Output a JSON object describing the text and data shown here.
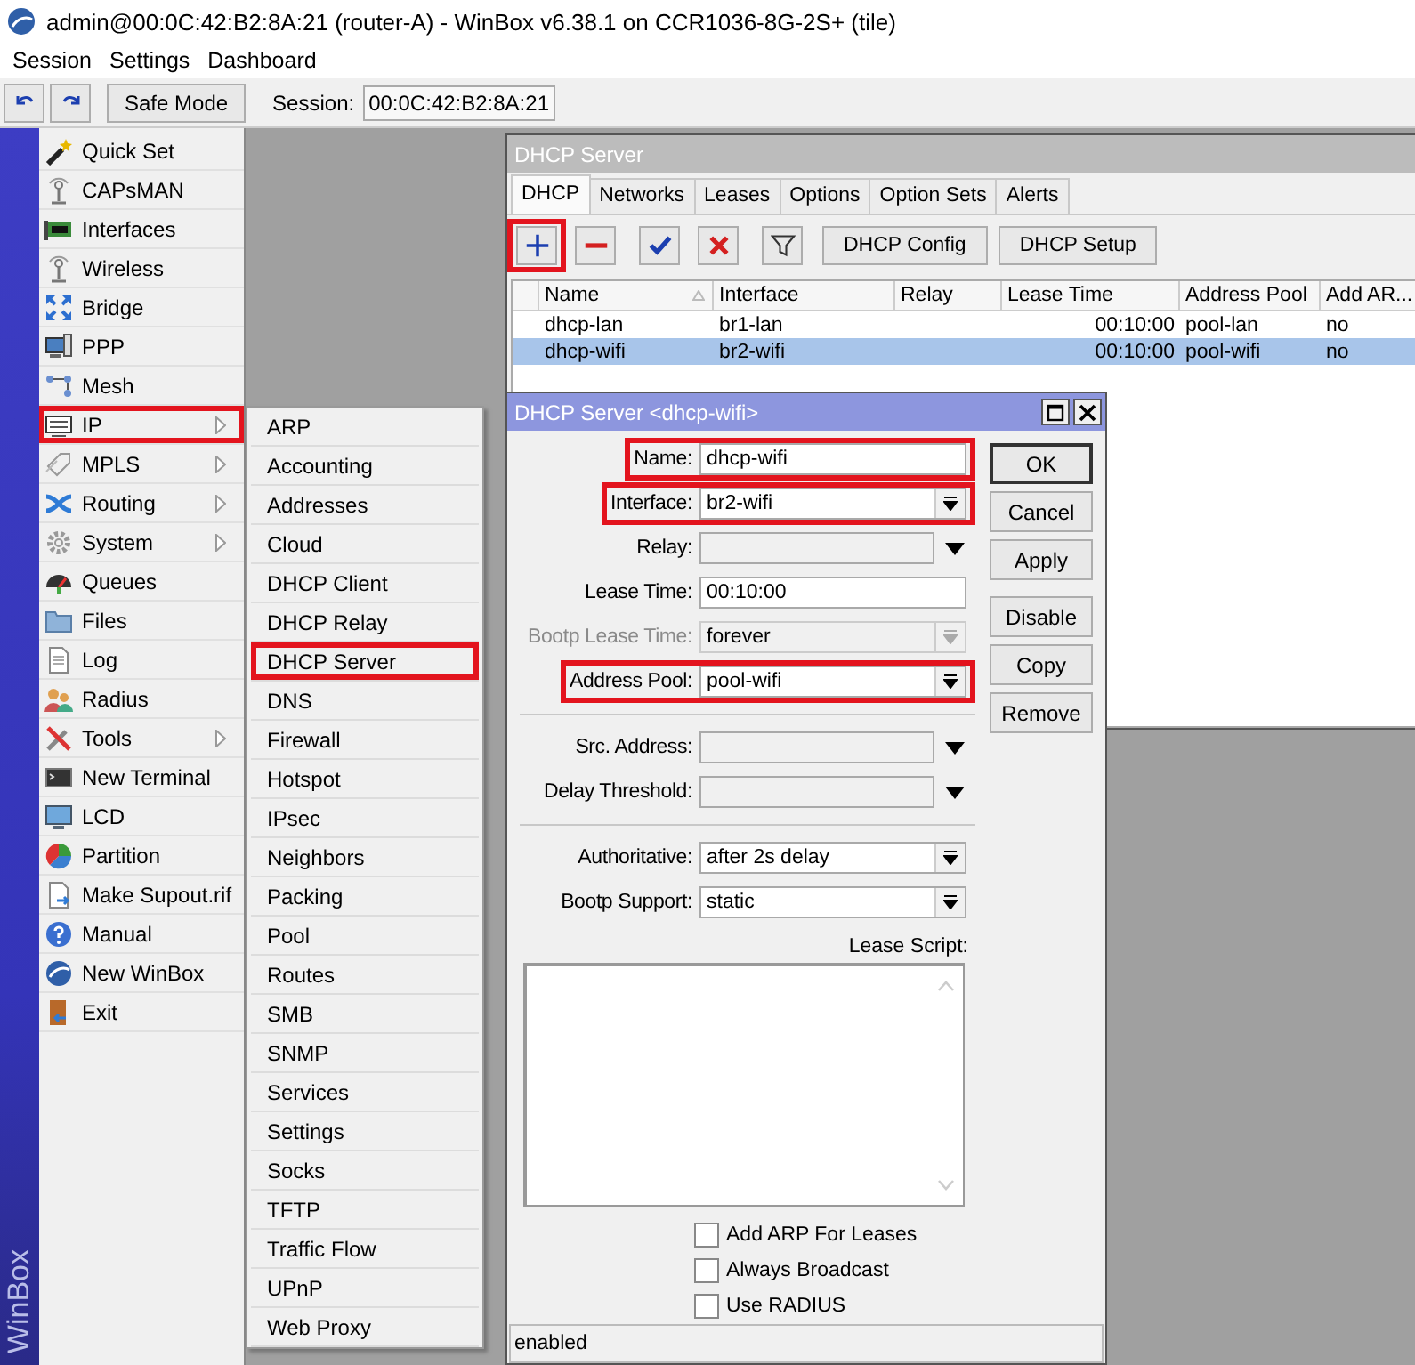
{
  "window": {
    "title": "admin@00:0C:42:B2:8A:21 (router-A) - WinBox v6.38.1 on CCR1036-8G-2S+ (tile)"
  },
  "menu_bar": [
    {
      "label": "Session"
    },
    {
      "label": "Settings"
    },
    {
      "label": "Dashboard"
    }
  ],
  "toolbar": {
    "safe_mode": "Safe Mode",
    "session_label": "Session:",
    "session_value": "00:0C:42:B2:8A:21"
  },
  "side_banner": "WinBox",
  "sidebar": {
    "items": [
      {
        "label": "Quick Set",
        "submenu": false,
        "highlighted": false
      },
      {
        "label": "CAPsMAN",
        "submenu": false,
        "highlighted": false
      },
      {
        "label": "Interfaces",
        "submenu": false,
        "highlighted": false
      },
      {
        "label": "Wireless",
        "submenu": false,
        "highlighted": false
      },
      {
        "label": "Bridge",
        "submenu": false,
        "highlighted": false
      },
      {
        "label": "PPP",
        "submenu": false,
        "highlighted": false
      },
      {
        "label": "Mesh",
        "submenu": false,
        "highlighted": false
      },
      {
        "label": "IP",
        "submenu": true,
        "highlighted": true
      },
      {
        "label": "MPLS",
        "submenu": true,
        "highlighted": false
      },
      {
        "label": "Routing",
        "submenu": true,
        "highlighted": false
      },
      {
        "label": "System",
        "submenu": true,
        "highlighted": false
      },
      {
        "label": "Queues",
        "submenu": false,
        "highlighted": false
      },
      {
        "label": "Files",
        "submenu": false,
        "highlighted": false
      },
      {
        "label": "Log",
        "submenu": false,
        "highlighted": false
      },
      {
        "label": "Radius",
        "submenu": false,
        "highlighted": false
      },
      {
        "label": "Tools",
        "submenu": true,
        "highlighted": false
      },
      {
        "label": "New Terminal",
        "submenu": false,
        "highlighted": false
      },
      {
        "label": "LCD",
        "submenu": false,
        "highlighted": false
      },
      {
        "label": "Partition",
        "submenu": false,
        "highlighted": false
      },
      {
        "label": "Make Supout.rif",
        "submenu": false,
        "highlighted": false
      },
      {
        "label": "Manual",
        "submenu": false,
        "highlighted": false
      },
      {
        "label": "New WinBox",
        "submenu": false,
        "highlighted": false
      },
      {
        "label": "Exit",
        "submenu": false,
        "highlighted": false
      }
    ]
  },
  "submenu": {
    "items": [
      {
        "label": "ARP",
        "highlighted": false
      },
      {
        "label": "Accounting",
        "highlighted": false
      },
      {
        "label": "Addresses",
        "highlighted": false
      },
      {
        "label": "Cloud",
        "highlighted": false
      },
      {
        "label": "DHCP Client",
        "highlighted": false
      },
      {
        "label": "DHCP Relay",
        "highlighted": false
      },
      {
        "label": "DHCP Server",
        "highlighted": true
      },
      {
        "label": "DNS",
        "highlighted": false
      },
      {
        "label": "Firewall",
        "highlighted": false
      },
      {
        "label": "Hotspot",
        "highlighted": false
      },
      {
        "label": "IPsec",
        "highlighted": false
      },
      {
        "label": "Neighbors",
        "highlighted": false
      },
      {
        "label": "Packing",
        "highlighted": false
      },
      {
        "label": "Pool",
        "highlighted": false
      },
      {
        "label": "Routes",
        "highlighted": false
      },
      {
        "label": "SMB",
        "highlighted": false
      },
      {
        "label": "SNMP",
        "highlighted": false
      },
      {
        "label": "Services",
        "highlighted": false
      },
      {
        "label": "Settings",
        "highlighted": false
      },
      {
        "label": "Socks",
        "highlighted": false
      },
      {
        "label": "TFTP",
        "highlighted": false
      },
      {
        "label": "Traffic Flow",
        "highlighted": false
      },
      {
        "label": "UPnP",
        "highlighted": false
      },
      {
        "label": "Web Proxy",
        "highlighted": false
      }
    ]
  },
  "dhcp_window": {
    "title": "DHCP Server",
    "tabs": [
      {
        "label": "DHCP",
        "selected": true
      },
      {
        "label": "Networks",
        "selected": false
      },
      {
        "label": "Leases",
        "selected": false
      },
      {
        "label": "Options",
        "selected": false
      },
      {
        "label": "Option Sets",
        "selected": false
      },
      {
        "label": "Alerts",
        "selected": false
      }
    ],
    "tools": [
      {
        "kind": "add",
        "highlighted": true
      },
      {
        "kind": "remove",
        "highlighted": false
      },
      {
        "kind": "enable",
        "highlighted": false
      },
      {
        "kind": "disable",
        "highlighted": false
      },
      {
        "kind": "filter",
        "highlighted": false
      }
    ],
    "buttons": [
      {
        "label": "DHCP Config"
      },
      {
        "label": "DHCP Setup"
      }
    ],
    "table": {
      "columns": [
        {
          "label": "Name",
          "sorted": true
        },
        {
          "label": "Interface",
          "sorted": false
        },
        {
          "label": "Relay",
          "sorted": false
        },
        {
          "label": "Lease Time",
          "sorted": false
        },
        {
          "label": "Address Pool",
          "sorted": false
        },
        {
          "label": "Add AR...",
          "sorted": false
        }
      ],
      "rows": [
        {
          "name": "dhcp-lan",
          "interface": "br1-lan",
          "lease_time": "00:10:00",
          "address_pool": "pool-lan",
          "add_arp": "no",
          "selected": false
        },
        {
          "name": "dhcp-wifi",
          "interface": "br2-wifi",
          "lease_time": "00:10:00",
          "address_pool": "pool-wifi",
          "add_arp": "no",
          "selected": true
        }
      ]
    }
  },
  "dialog": {
    "title": "DHCP Server <dhcp-wifi>",
    "field_groups": [
      [
        {
          "label": "Name:",
          "value": "dhcp-wifi",
          "kind": "text",
          "disabled": false,
          "highlighted": true
        },
        {
          "label": "Interface:",
          "value": "br2-wifi",
          "kind": "select",
          "disabled": false,
          "highlighted": true
        },
        {
          "label": "Relay:",
          "kind": "combo",
          "disabled": false,
          "highlighted": false
        },
        {
          "label": "Lease Time:",
          "value": "00:10:00",
          "kind": "text",
          "disabled": false,
          "highlighted": false
        },
        {
          "label": "Bootp Lease Time:",
          "value": "forever",
          "kind": "select",
          "disabled": true,
          "highlighted": false
        },
        {
          "label": "Address Pool:",
          "value": "pool-wifi",
          "kind": "select",
          "disabled": false,
          "highlighted": true
        }
      ],
      [
        {
          "label": "Src. Address:",
          "kind": "combo",
          "disabled": false,
          "highlighted": false
        },
        {
          "label": "Delay Threshold:",
          "kind": "combo",
          "disabled": false,
          "highlighted": false
        }
      ],
      [
        {
          "label": "Authoritative:",
          "value": "after 2s delay",
          "kind": "select",
          "disabled": false,
          "highlighted": false
        },
        {
          "label": "Bootp Support:",
          "value": "static",
          "kind": "select",
          "disabled": false,
          "highlighted": false
        }
      ]
    ],
    "button_groups": [
      [
        {
          "label": "OK",
          "default": true
        },
        {
          "label": "Cancel",
          "default": false
        },
        {
          "label": "Apply",
          "default": false
        }
      ],
      [
        {
          "label": "Disable",
          "default": false
        },
        {
          "label": "Copy",
          "default": false
        },
        {
          "label": "Remove",
          "default": false
        }
      ]
    ],
    "lease_script": {
      "label": "Lease Script:"
    },
    "checkboxes": [
      {
        "label": "Add ARP For Leases",
        "checked": false
      },
      {
        "label": "Always Broadcast",
        "checked": false
      },
      {
        "label": "Use RADIUS",
        "checked": false
      }
    ],
    "status": "enabled"
  }
}
